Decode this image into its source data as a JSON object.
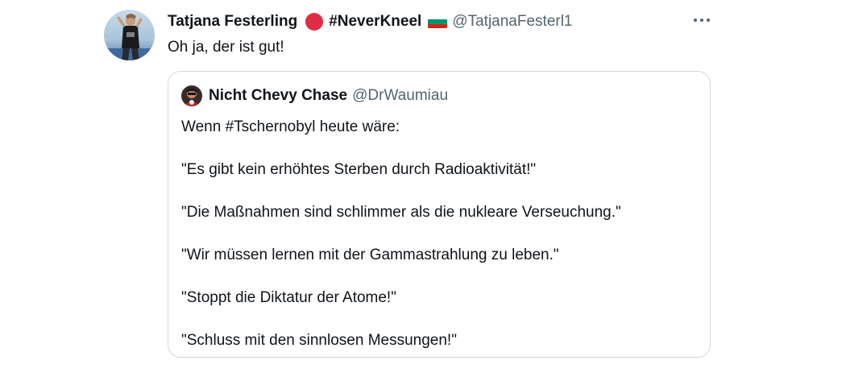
{
  "tweet": {
    "author_name": "Tatjana Festerling",
    "author_tag": "#NeverKneel",
    "author_handle": "@TatjanaFesterl1",
    "text": "Oh ja, der ist gut!",
    "icons": {
      "avatar": "profile-photo",
      "status": "red-circle-emoji",
      "flag": "bulgaria-flag-emoji",
      "more": "more-horizontal-icon"
    },
    "colors": {
      "text": "#0f1419",
      "secondary": "#536471",
      "border": "#cfd9de",
      "red_circle": "#dd2e44"
    }
  },
  "quote": {
    "author_name": "Nicht Chevy Chase",
    "author_handle": "@DrWaumiau",
    "lines": [
      "Wenn #Tschernobyl heute wäre:",
      "\"Es gibt kein erhöhtes Sterben durch Radioaktivität!\"",
      "\"Die Maßnahmen sind schlimmer als die nukleare Verseuchung.\"",
      "\"Wir müssen lernen mit der Gammastrahlung zu leben.\"",
      "\"Stoppt die Diktatur der Atome!\"",
      "\"Schluss mit den sinnlosen Messungen!\""
    ]
  }
}
